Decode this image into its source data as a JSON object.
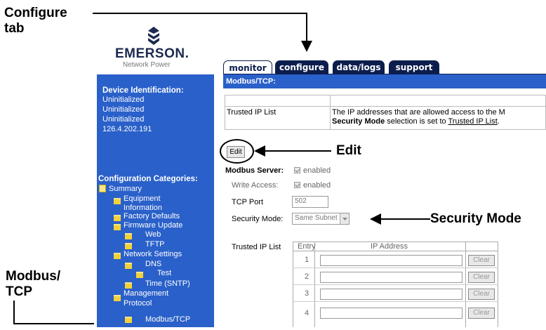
{
  "callouts": {
    "configure_tab": [
      "Configure",
      "tab"
    ],
    "edit": "Edit",
    "security_mode": "Security Mode",
    "modbus_tcp": [
      "Modbus/",
      "TCP"
    ]
  },
  "logo": {
    "name": "EMERSON.",
    "sub": "Network Power"
  },
  "tabs": [
    {
      "label": "monitor",
      "active": true
    },
    {
      "label": "configure",
      "active": false
    },
    {
      "label": "data/logs",
      "active": false
    },
    {
      "label": "support",
      "active": false
    }
  ],
  "device": {
    "heading": "Device Identification:",
    "lines": [
      "Uninitialized",
      "Uninitialized",
      "Uninitialized",
      "126.4.202.191"
    ]
  },
  "categories": {
    "heading": "Configuration Categories:",
    "items": [
      {
        "label": "Summary"
      },
      {
        "label": "Equipment"
      },
      {
        "label": "Information"
      },
      {
        "label": "Factory Defaults"
      },
      {
        "label": "Firmware Update"
      },
      {
        "label": "Web"
      },
      {
        "label": "TFTP"
      },
      {
        "label": "Network Settings"
      },
      {
        "label": "DNS"
      },
      {
        "label": "Test"
      },
      {
        "label": "Time (SNTP)"
      },
      {
        "label": "Management"
      },
      {
        "label": "Protocol"
      },
      {
        "label": "Modbus/TCP"
      }
    ]
  },
  "content": {
    "title": "Modbus/TCP:",
    "info_table": {
      "label": "Trusted IP List",
      "desc_line1": "The IP addresses that are allowed access to the M",
      "desc_line2_prefix": "Security Mode",
      "desc_line2_mid": " selection is set to ",
      "desc_line2_link": "Trusted IP List",
      "desc_line2_suffix": "."
    },
    "edit_button": "Edit",
    "modbus_server": {
      "label": "Modbus Server:",
      "value": "enabled"
    },
    "write_access": {
      "label": "Write Access:",
      "value": "enabled"
    },
    "tcp_port": {
      "label": "TCP Port",
      "value": "502"
    },
    "security_mode": {
      "label": "Security Mode:",
      "value": "Same Subnet"
    },
    "trusted_ip": {
      "label": "Trusted IP List",
      "col_entry": "Entry",
      "col_ip": "IP Address",
      "rows": [
        {
          "entry": "1",
          "ip": "",
          "button": "Clear"
        },
        {
          "entry": "2",
          "ip": "",
          "button": "Clear"
        },
        {
          "entry": "3",
          "ip": "",
          "button": "Clear"
        },
        {
          "entry": "4",
          "ip": "",
          "button": "Clear"
        }
      ]
    }
  },
  "colors": {
    "navy": "#0c1d4d",
    "panel_blue": "#2a60c9",
    "folder": "#f2d23a"
  }
}
